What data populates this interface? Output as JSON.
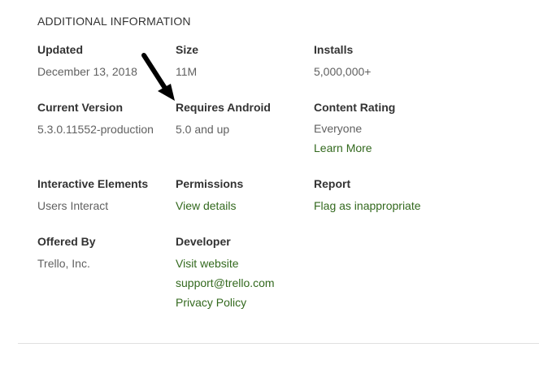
{
  "section_title": "ADDITIONAL INFORMATION",
  "rows": [
    [
      {
        "label": "Updated",
        "value": "December 13, 2018"
      },
      {
        "label": "Size",
        "value": "11M"
      },
      {
        "label": "Installs",
        "value": "5,000,000+"
      }
    ],
    [
      {
        "label": "Current Version",
        "value": "5.3.0.11552-production"
      },
      {
        "label": "Requires Android",
        "value": "5.0 and up"
      },
      {
        "label": "Content Rating",
        "value": "Everyone",
        "links": [
          "Learn More"
        ]
      }
    ],
    [
      {
        "label": "Interactive Elements",
        "value": "Users Interact"
      },
      {
        "label": "Permissions",
        "links": [
          "View details"
        ]
      },
      {
        "label": "Report",
        "links": [
          "Flag as inappropriate"
        ]
      }
    ],
    [
      {
        "label": "Offered By",
        "value": "Trello, Inc."
      },
      {
        "label": "Developer",
        "links": [
          "Visit website",
          "support@trello.com",
          "Privacy Policy"
        ]
      }
    ]
  ],
  "colors": {
    "link": "#33691e",
    "label": "#333333",
    "value": "#616161",
    "annotation_arrow": "#000000"
  },
  "annotation": {
    "icon": "arrow-down-right-icon"
  }
}
